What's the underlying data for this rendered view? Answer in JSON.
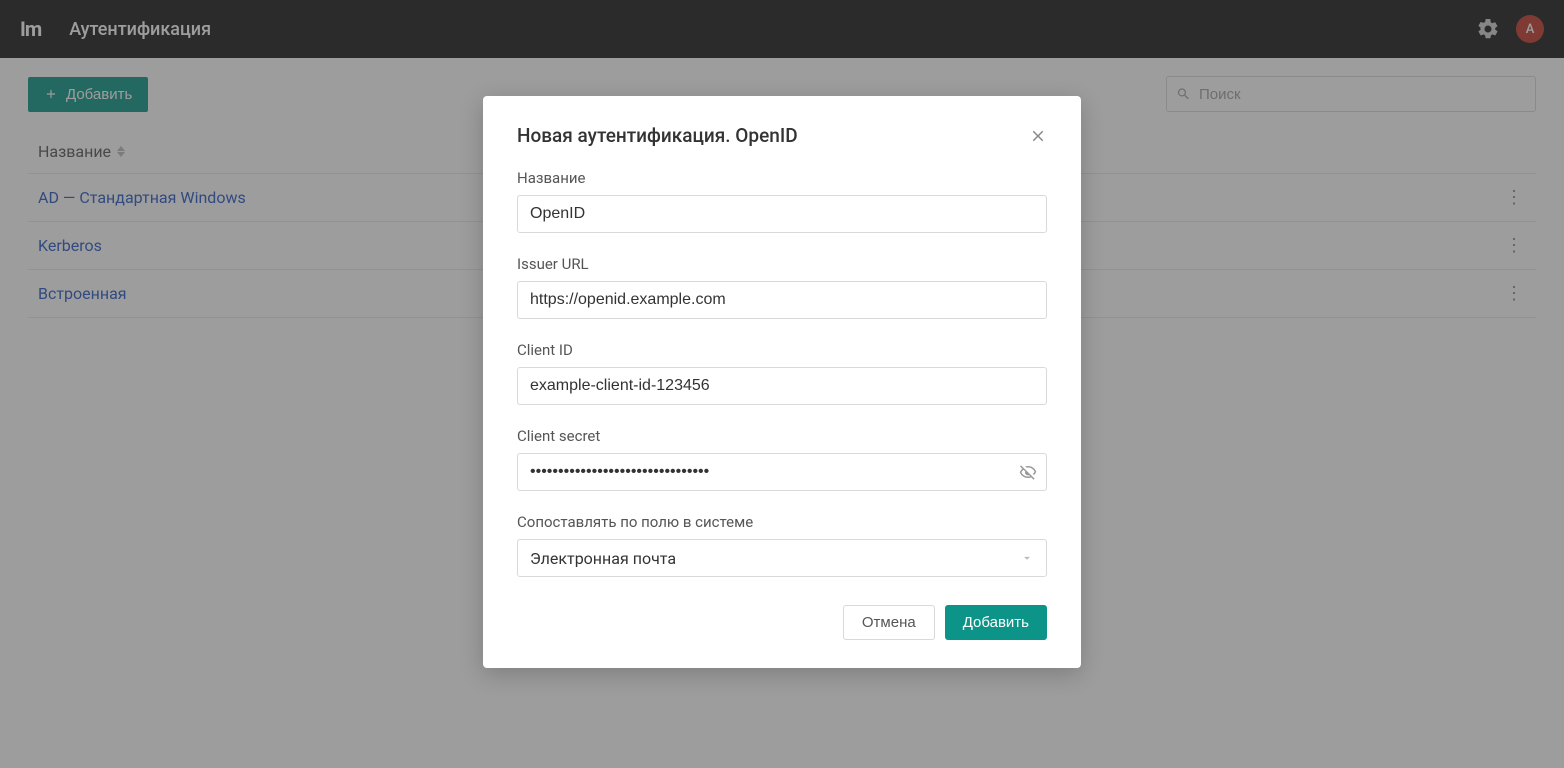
{
  "header": {
    "logo": "Im",
    "title": "Аутентификация",
    "avatar_initial": "A"
  },
  "toolbar": {
    "add_label": "Добавить"
  },
  "search": {
    "placeholder": "Поиск"
  },
  "table": {
    "column_label": "Название",
    "rows": [
      {
        "name": "AD — Стандартная Windows"
      },
      {
        "name": "Kerberos"
      },
      {
        "name": "Встроенная"
      }
    ]
  },
  "dialog": {
    "title": "Новая аутентификация. OpenID",
    "fields": {
      "name": {
        "label": "Название",
        "value": "OpenID"
      },
      "issuer": {
        "label": "Issuer URL",
        "value": "https://openid.example.com"
      },
      "client_id": {
        "label": "Client ID",
        "value": "example-client-id-123456"
      },
      "client_secret": {
        "label": "Client secret",
        "value": "••••••••••••••••••••••••••••••••"
      },
      "match": {
        "label": "Сопоставлять по полю в системе",
        "value": "Электронная почта"
      }
    },
    "cancel_label": "Отмена",
    "submit_label": "Добавить"
  }
}
